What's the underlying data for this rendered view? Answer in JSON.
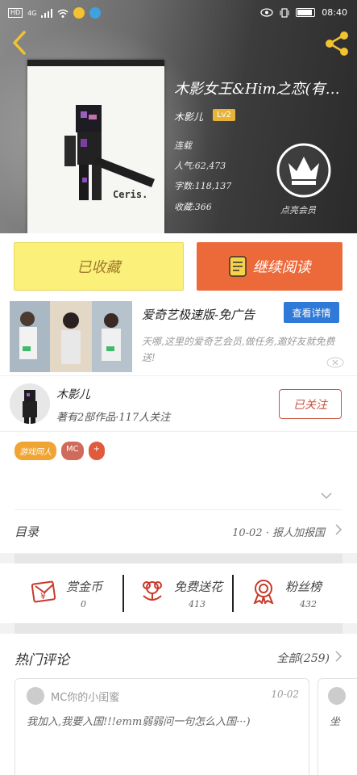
{
  "status_bar": {
    "left_badge": "HD",
    "signal": "4G",
    "time": "08:40"
  },
  "book": {
    "title": "木影女王&Him之恋(有…",
    "author": "木影儿",
    "level": "Lv2",
    "status": "连载",
    "popularity": "人气:62,473",
    "word_count": "字数:118,137",
    "favorites": "收藏:366",
    "cover_text": "Ceris."
  },
  "vip": {
    "label": "点亮会员"
  },
  "actions": {
    "collect_label": "已收藏",
    "read_label": "继续阅读"
  },
  "ad": {
    "title": "爱奇艺极速版-免广告",
    "detail_label": "查看详情",
    "description": "天哪,这里的爱奇艺会员,做任务,邀好友就免费送!"
  },
  "author_card": {
    "name": "木影儿",
    "stats": "著有2部作品·117人关注",
    "follow_label": "已关注"
  },
  "tags": [
    {
      "label": "游戏同人",
      "color": "#f0a533"
    },
    {
      "label": "MC",
      "color": "#d06a5a"
    },
    {
      "label": "+",
      "color": "#e05a3c"
    }
  ],
  "catalog": {
    "label": "目录",
    "latest": "10-02 · 报人加报国"
  },
  "gifts": [
    {
      "label": "赏金币",
      "count": "0"
    },
    {
      "label": "免费送花",
      "count": "413"
    },
    {
      "label": "粉丝榜",
      "count": "432"
    }
  ],
  "comments": {
    "title": "热门评论",
    "all_label": "全部(259)",
    "items": [
      {
        "user": "MC你的小闺蜜",
        "date": "10-02",
        "text": "我加入,我要入国!!!emm弱弱问一句怎么入国···)"
      },
      {
        "text": "坐"
      }
    ]
  }
}
